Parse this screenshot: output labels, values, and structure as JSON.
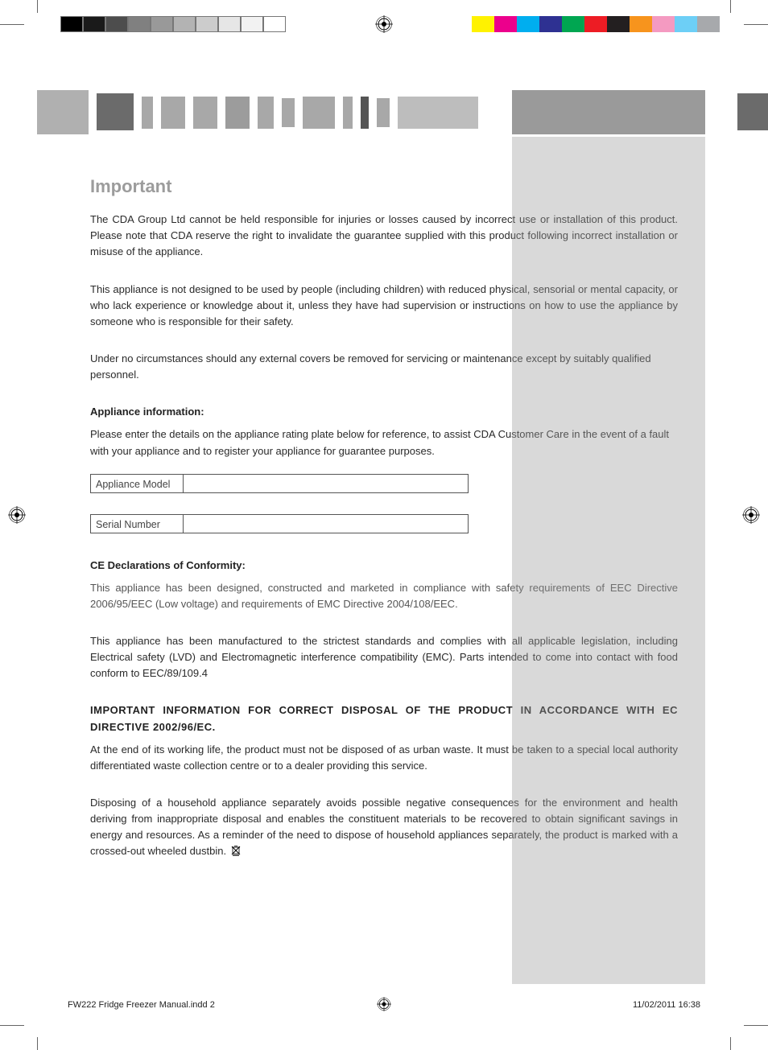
{
  "heading": "Important",
  "para1": "The CDA Group Ltd cannot be held responsible for injuries or losses caused by incorrect use or installation of this product. Please note that CDA reserve the right to invalidate the guarantee supplied with this product following incorrect installation or misuse of the appliance.",
  "para2": "This appliance is not designed to be used by people (including children) with reduced physical, sensorial or mental capacity, or who lack experience or knowledge about it, unless they have had supervision or instructions on how to use the appliance by someone who is responsible for their safety.",
  "para3": "Under no circumstances should any external covers be removed for servicing or maintenance except by suitably qualified personnel.",
  "appliance_info_heading": "Appliance information:",
  "appliance_info_text": "Please enter the details on the appliance rating plate below for reference, to assist CDA Customer Care in the event of a fault with your appliance and to register your appliance for guarantee purposes.",
  "fields": {
    "model_label": "Appliance Model",
    "model_value": "",
    "serial_label": "Serial Number",
    "serial_value": ""
  },
  "ce_heading": "CE Declarations of Conformity:",
  "ce_body1": "This appliance has been designed, constructed and marketed in compliance with safety requirements of EEC Directive 2006/95/EEC (Low voltage) and requirements of EMC Directive 2004/108/EEC.",
  "ce_body2": "This appliance has been manufactured to the strictest standards and complies with all applicable legislation, including Electrical safety (LVD) and Electromagnetic interference compatibility (EMC). Parts intended to come into contact with food conform to EEC/89/109.4",
  "disposal_heading": "IMPORTANT INFORMATION FOR CORRECT DISPOSAL OF THE PRODUCT IN ACCORDANCE WITH EC DIRECTIVE 2002/96/EC.",
  "disposal_body1": "At the end of its working life, the product must not be disposed of as urban waste. It must be taken to a special local authority differentiated waste collection centre or to a dealer providing this service.",
  "disposal_body2": "Disposing of a household appliance separately avoids possible negative consequences for the environment and health deriving from inappropriate disposal and enables the constituent materials to be recovered to obtain significant savings in energy and resources. As a reminder of the need to dispose of household appliances separately, the product is marked with a crossed-out wheeled dustbin.",
  "footer": {
    "file": "FW222 Fridge Freezer Manual.indd   2",
    "datetime": "11/02/2011   16:38"
  },
  "print_marks": {
    "grayscale_swatches": [
      "#000000",
      "#1a1a1a",
      "#4d4d4d",
      "#808080",
      "#999999",
      "#b3b3b3",
      "#cccccc",
      "#e6e6e6",
      "#f2f2f2",
      "#ffffff"
    ],
    "color_swatches": [
      "#fff200",
      "#ec008c",
      "#00aeef",
      "#2e3192",
      "#00a651",
      "#ed1c24",
      "#231f20",
      "#f7941d",
      "#f49ac1",
      "#6dcff6",
      "#a7a9ac"
    ]
  }
}
